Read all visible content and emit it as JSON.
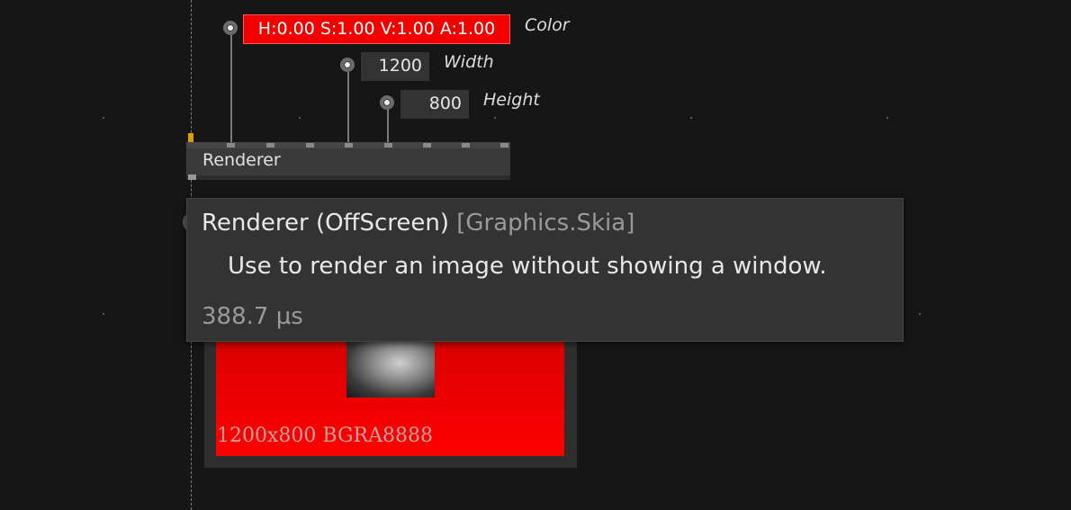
{
  "pins": [
    {
      "name": "Color",
      "value": "H:0.00 S:1.00 V:1.00 A:1.00"
    },
    {
      "name": "Width",
      "value": "1200"
    },
    {
      "name": "Height",
      "value": "800"
    }
  ],
  "node": {
    "title": "Renderer"
  },
  "preview": {
    "caption": "1200x800 BGRA8888"
  },
  "tooltip": {
    "title": "Renderer (OffScreen)",
    "category": "[Graphics.Skia]",
    "description": "Use to render an image without showing a window.",
    "timing": "388.7 µs"
  },
  "colors": {
    "accent_red": "#ff0000",
    "pin_marker": "#d9a000"
  }
}
